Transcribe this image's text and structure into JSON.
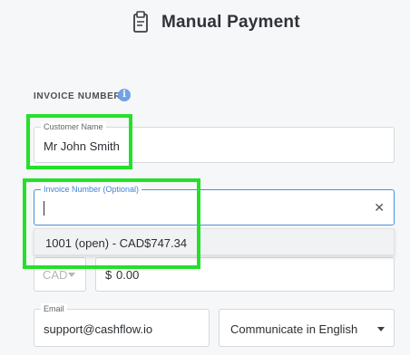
{
  "header": {
    "title": "Manual Payment",
    "icon": "document-icon"
  },
  "section": {
    "label": "INVOICE NUMBER",
    "info_icon": "i"
  },
  "customer_name": {
    "legend": "Customer Name",
    "value": "Mr John Smith"
  },
  "invoice_number": {
    "legend": "Invoice Number (Optional)",
    "value": "",
    "clear_icon": "✕"
  },
  "dropdown": {
    "options": [
      "1001 (open) - CAD$747.34"
    ]
  },
  "currency": {
    "value": "CAD"
  },
  "amount": {
    "currency_symbol": "$",
    "value": "0.00"
  },
  "email": {
    "legend": "Email",
    "value": "support@cashflow.io"
  },
  "language": {
    "value": "Communicate in English"
  },
  "colors": {
    "highlight": "#25e02a",
    "focus": "#4a8fe0",
    "info": "#6fa3e8"
  }
}
